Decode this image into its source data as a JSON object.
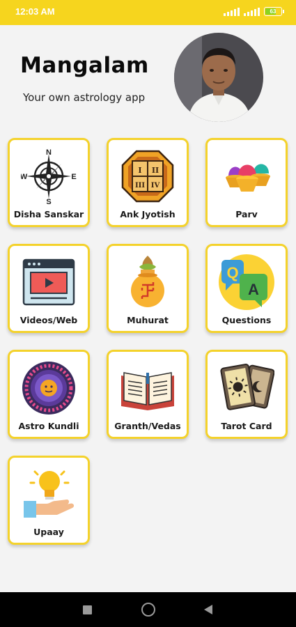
{
  "status_bar": {
    "time": "12:03 AM",
    "battery": "63",
    "battery_level": 0.63
  },
  "header": {
    "title": "Mangalam",
    "subtitle": "Your own astrology app"
  },
  "menu": [
    {
      "label": "Disha Sanskar",
      "icon": "compass-icon"
    },
    {
      "label": "Ank Jyotish",
      "icon": "numerology-tablet-icon"
    },
    {
      "label": "Parv",
      "icon": "holi-colors-icon"
    },
    {
      "label": "Videos/Web",
      "icon": "video-player-icon"
    },
    {
      "label": "Muhurat",
      "icon": "kalash-icon"
    },
    {
      "label": "Questions",
      "icon": "qa-bubbles-icon"
    },
    {
      "label": "Astro Kundli",
      "icon": "zodiac-wheel-icon"
    },
    {
      "label": "Granth/Vedas",
      "icon": "open-book-icon"
    },
    {
      "label": "Tarot Card",
      "icon": "tarot-cards-icon"
    },
    {
      "label": "Upaay",
      "icon": "lightbulb-hand-icon"
    }
  ],
  "colors": {
    "accent": "#f6d51e",
    "tile_border": "#f4d22b",
    "background": "#f3f3f3"
  },
  "nav": {
    "recents": "square-icon",
    "home": "circle-icon",
    "back": "triangle-back-icon"
  }
}
